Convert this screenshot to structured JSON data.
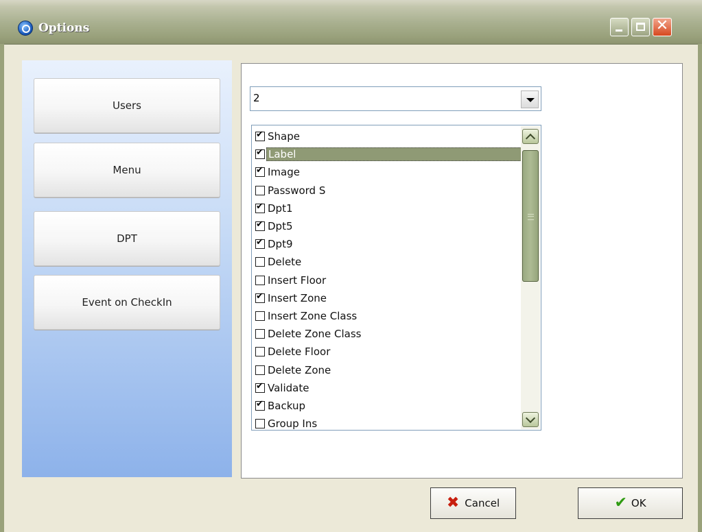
{
  "window": {
    "title": "Options"
  },
  "sidebar": {
    "items": [
      {
        "label": "Users"
      },
      {
        "label": "Menu"
      },
      {
        "label": "DPT"
      },
      {
        "label": "Event on CheckIn"
      }
    ]
  },
  "combo": {
    "value": "2"
  },
  "list": {
    "selected_index": 1,
    "items": [
      {
        "label": "Shape",
        "checked": true
      },
      {
        "label": "Label",
        "checked": true
      },
      {
        "label": "Image",
        "checked": true
      },
      {
        "label": "Password S",
        "checked": false
      },
      {
        "label": "Dpt1",
        "checked": true
      },
      {
        "label": "Dpt5",
        "checked": true
      },
      {
        "label": "Dpt9",
        "checked": true
      },
      {
        "label": "Delete",
        "checked": false
      },
      {
        "label": "Insert Floor",
        "checked": false
      },
      {
        "label": "Insert Zone",
        "checked": true
      },
      {
        "label": "Insert Zone Class",
        "checked": false
      },
      {
        "label": "Delete Zone Class",
        "checked": false
      },
      {
        "label": "Delete Floor",
        "checked": false
      },
      {
        "label": "Delete Zone",
        "checked": false
      },
      {
        "label": "Validate",
        "checked": true
      },
      {
        "label": "Backup",
        "checked": true
      },
      {
        "label": "Group Ins",
        "checked": false
      }
    ]
  },
  "buttons": {
    "cancel_label": "Cancel",
    "ok_label": "OK"
  },
  "icons": {
    "app": "app-logo-icon",
    "cancel": "x-icon",
    "ok": "checkmark-icon"
  }
}
